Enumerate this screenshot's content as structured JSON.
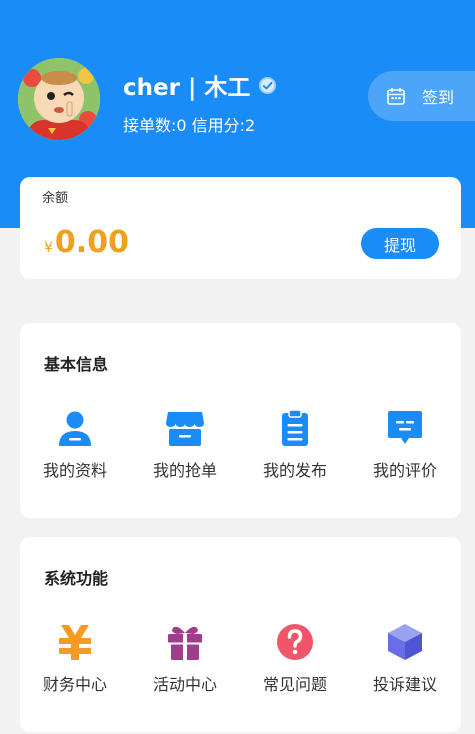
{
  "profile": {
    "name": "cher | 木工",
    "stats": "接单数:0 信用分:2",
    "checkin_label": "签到"
  },
  "balance": {
    "label": "余额",
    "currency": "¥",
    "amount": "0.00",
    "withdraw_label": "提现"
  },
  "basic_info": {
    "title": "基本信息",
    "items": [
      {
        "label": "我的资料",
        "icon": "profile-icon",
        "color": "#1a8cf7"
      },
      {
        "label": "我的抢单",
        "icon": "store-icon",
        "color": "#1a8cf7"
      },
      {
        "label": "我的发布",
        "icon": "clipboard-icon",
        "color": "#1a8cf7"
      },
      {
        "label": "我的评价",
        "icon": "comment-icon",
        "color": "#1a8cf7"
      }
    ]
  },
  "system": {
    "title": "系统功能",
    "items": [
      {
        "label": "财务中心",
        "icon": "yen-icon",
        "color": "#f59a23"
      },
      {
        "label": "活动中心",
        "icon": "gift-icon",
        "color": "#a23c8c"
      },
      {
        "label": "常见问题",
        "icon": "question-icon",
        "color": "#f0566a"
      },
      {
        "label": "投诉建议",
        "icon": "cube-icon",
        "color": "#6a6ee6"
      }
    ]
  },
  "colors": {
    "primary": "#1a8cf7",
    "balance": "#f0a020",
    "background": "#f2f2f2"
  }
}
